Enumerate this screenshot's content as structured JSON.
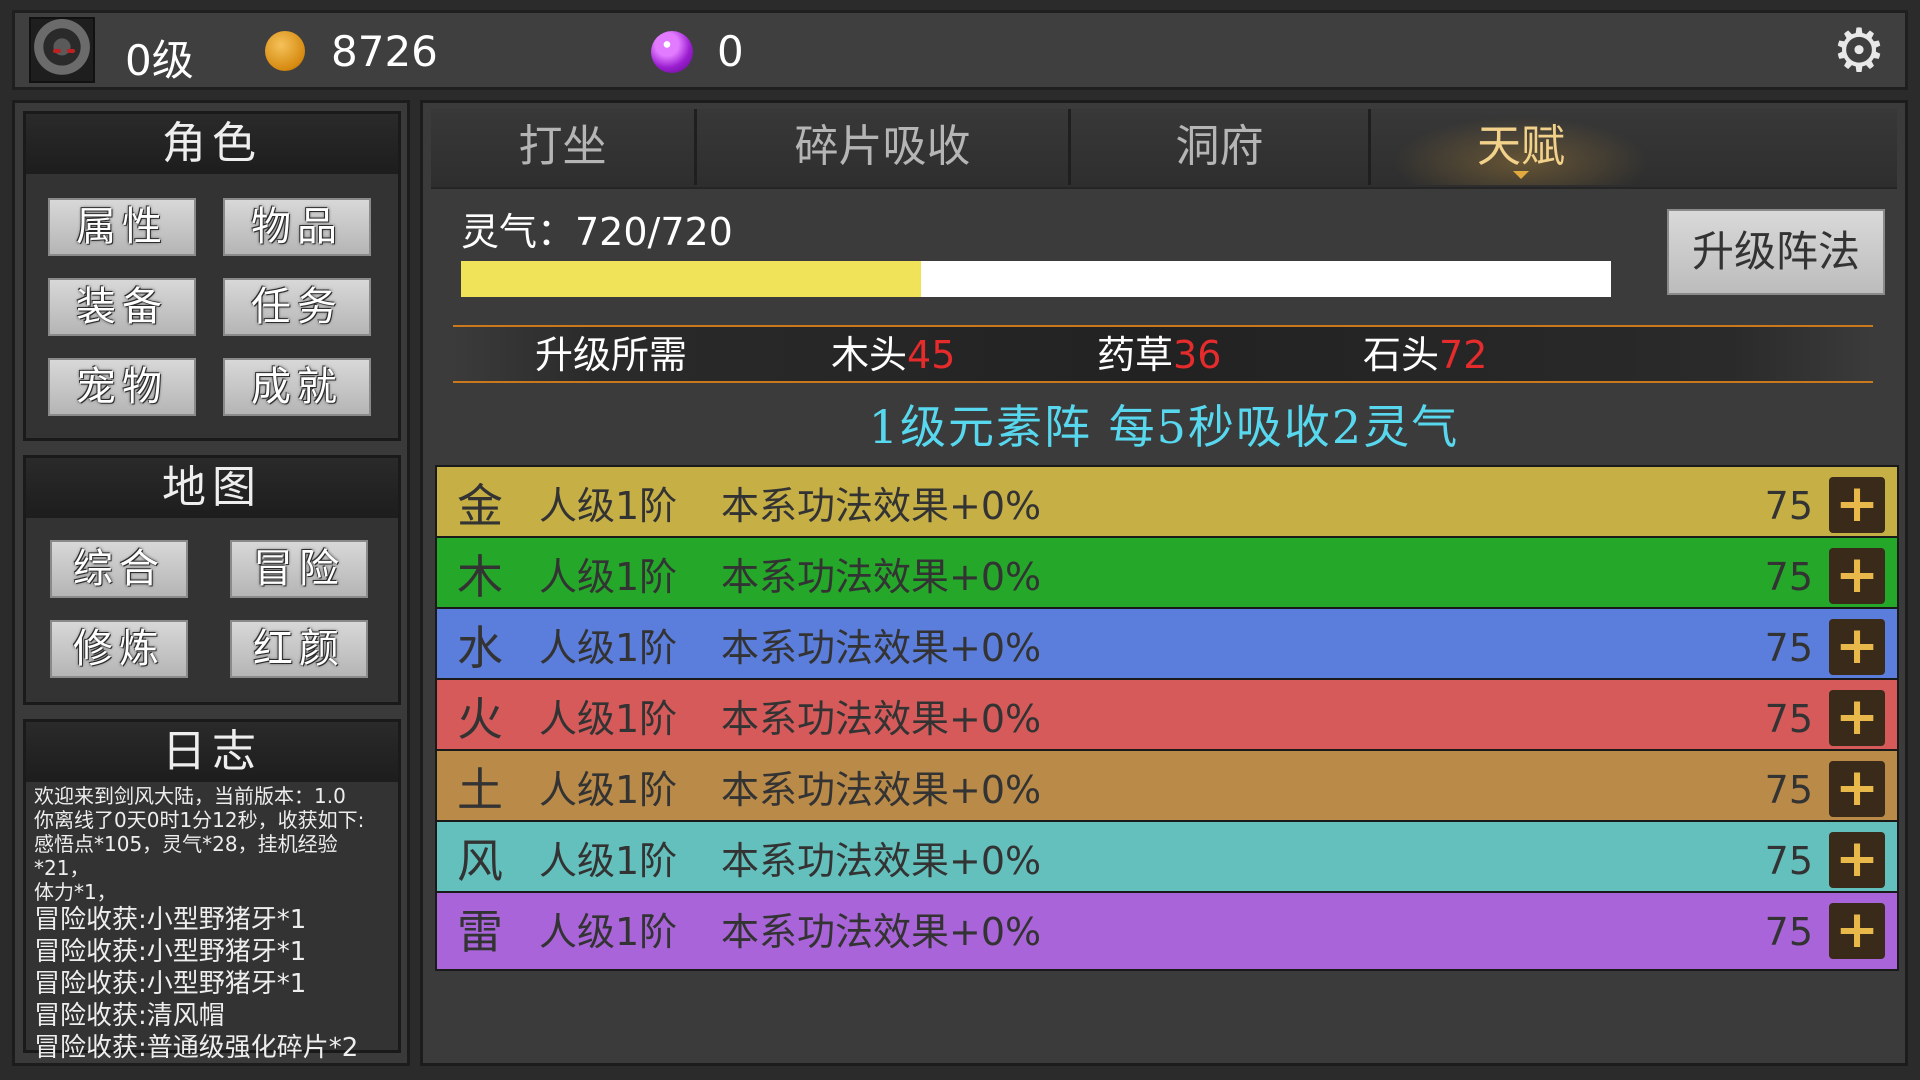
{
  "player": {
    "level": "0级",
    "coins": "8726",
    "gems": "0"
  },
  "sidebar": {
    "role": {
      "title": "角色",
      "buttons": [
        "属性",
        "物品",
        "装备",
        "任务",
        "宠物",
        "成就"
      ]
    },
    "map": {
      "title": "地图",
      "buttons": [
        "综合",
        "冒险",
        "修炼",
        "红颜"
      ]
    },
    "log": {
      "title": "日志",
      "lines_small": [
        "欢迎来到剑风大陆，当前版本：1.0",
        "你离线了0天0时1分12秒，收获如下:",
        "感悟点*105，灵气*28，挂机经验*21，",
        "体力*1，"
      ],
      "lines_big": [
        "冒险收获:小型野猪牙*1",
        "冒险收获:小型野猪牙*1",
        "冒险收获:小型野猪牙*1",
        "冒险收获:清风帽",
        "冒险收获:普通级强化碎片*2"
      ]
    }
  },
  "tabs": [
    "打坐",
    "碎片吸收",
    "洞府",
    "天赋"
  ],
  "main": {
    "qi_label": "灵气：720/720",
    "upgrade_button": "升级阵法",
    "requirements": {
      "label": "升级所需",
      "wood_label": "木头",
      "wood_value": "45",
      "herb_label": "药草",
      "herb_value": "36",
      "stone_label": "石头",
      "stone_value": "72"
    },
    "array_info": "1级元素阵 每5秒吸收2灵气",
    "elements": [
      {
        "name": "金",
        "rank": "人级1阶",
        "effect": "本系功法效果+0%",
        "cost": "75",
        "color": "#c6b046"
      },
      {
        "name": "木",
        "rank": "人级1阶",
        "effect": "本系功法效果+0%",
        "cost": "75",
        "color": "#25a82a"
      },
      {
        "name": "水",
        "rank": "人级1阶",
        "effect": "本系功法效果+0%",
        "cost": "75",
        "color": "#5b7ddc"
      },
      {
        "name": "火",
        "rank": "人级1阶",
        "effect": "本系功法效果+0%",
        "cost": "75",
        "color": "#d65a5a"
      },
      {
        "name": "土",
        "rank": "人级1阶",
        "effect": "本系功法效果+0%",
        "cost": "75",
        "color": "#b98a48"
      },
      {
        "name": "风",
        "rank": "人级1阶",
        "effect": "本系功法效果+0%",
        "cost": "75",
        "color": "#64c0bd"
      },
      {
        "name": "雷",
        "rank": "人级1阶",
        "effect": "本系功法效果+0%",
        "cost": "75",
        "color": "#a864d8"
      }
    ],
    "plus_symbol": "+"
  },
  "icons": {
    "settings": "gear-icon",
    "coin": "gold-coin-icon",
    "gem": "purple-gem-icon",
    "avatar": "hooded-avatar-icon"
  }
}
